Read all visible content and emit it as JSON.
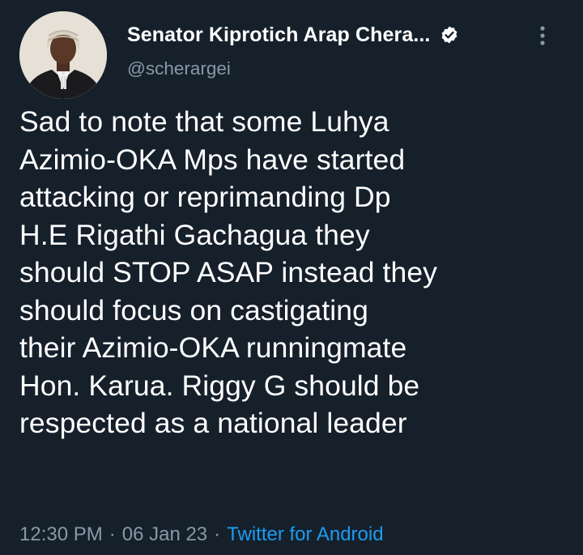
{
  "author": {
    "display_name": "Senator Kiprotich Arap Chera...",
    "handle": "@scherargei",
    "avatar_icon": "profile-photo",
    "verified_icon": "verified-badge-icon"
  },
  "tweet": {
    "text": "Sad to note that some Luhya\nAzimio-OKA Mps have started\nattacking or reprimanding Dp\nH.E Rigathi Gachagua they\nshould STOP ASAP instead they\nshould focus on castigating\ntheir  Azimio-OKA runningmate\nHon. Karua. Riggy G should be\nrespected as a national leader",
    "time": "12:30 PM",
    "date": "06 Jan 23",
    "separator": "·",
    "source": "Twitter for Android"
  },
  "colors": {
    "background": "#15202b",
    "text": "#ffffff",
    "muted": "#8899a6",
    "accent": "#1d9bf0"
  }
}
